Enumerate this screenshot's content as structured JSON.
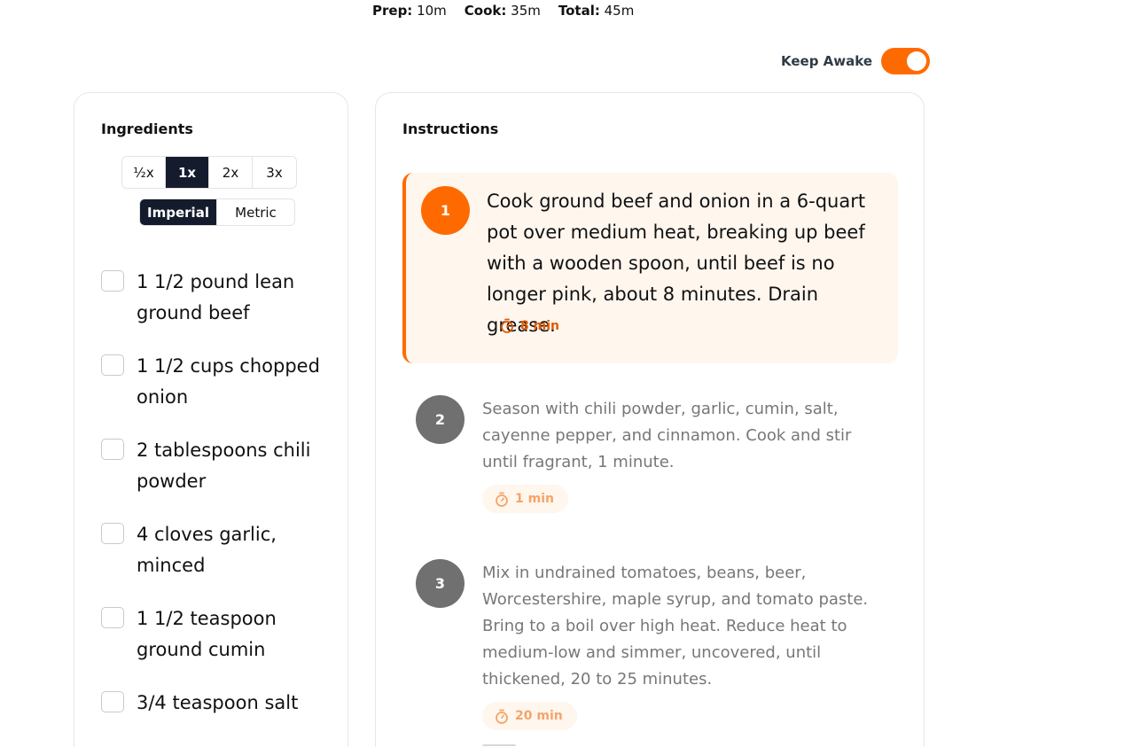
{
  "meta": {
    "prep_label": "Prep:",
    "prep_value": "10m",
    "cook_label": "Cook:",
    "cook_value": "35m",
    "total_label": "Total:",
    "total_value": "45m"
  },
  "keep_awake": {
    "label": "Keep Awake",
    "enabled": true
  },
  "ingredients": {
    "title": "Ingredients",
    "scales": [
      "½x",
      "1x",
      "2x",
      "3x"
    ],
    "active_scale": "1x",
    "units": [
      "Imperial",
      "Metric"
    ],
    "active_unit": "Imperial",
    "items": [
      "1 1/2 pound lean ground beef",
      "1 1/2 cups chopped onion",
      "2 tablespoons chili powder",
      "4 cloves garlic, minced",
      "1 1/2 teaspoon ground cumin",
      "3/4 teaspoon salt"
    ]
  },
  "instructions": {
    "title": "Instructions",
    "steps": [
      {
        "number": "1",
        "text": "Cook ground beef and onion in a 6-quart pot over medium heat, breaking up beef with a wooden spoon, until beef is no longer pink, about 8 minutes. Drain grease.",
        "timer": "8 min"
      },
      {
        "number": "2",
        "text": "Season with chili powder, garlic, cumin, salt, cayenne pepper, and cinnamon. Cook and stir until fragrant, 1 minute.",
        "timer": "1 min"
      },
      {
        "number": "3",
        "text": "Mix in undrained tomatoes, beans, beer, Worcestershire, maple syrup, and tomato paste. Bring to a boil over high heat. Reduce heat to medium-low and simmer, uncovered, until thickened, 20 to 25 minutes.",
        "timer": "20 min"
      }
    ]
  },
  "colors": {
    "accent": "#ff6a00",
    "dark": "#141b2d",
    "inactive_step": "#707070"
  },
  "icons": {
    "timer": "stopwatch-icon",
    "checkbox": "checkbox-icon"
  }
}
